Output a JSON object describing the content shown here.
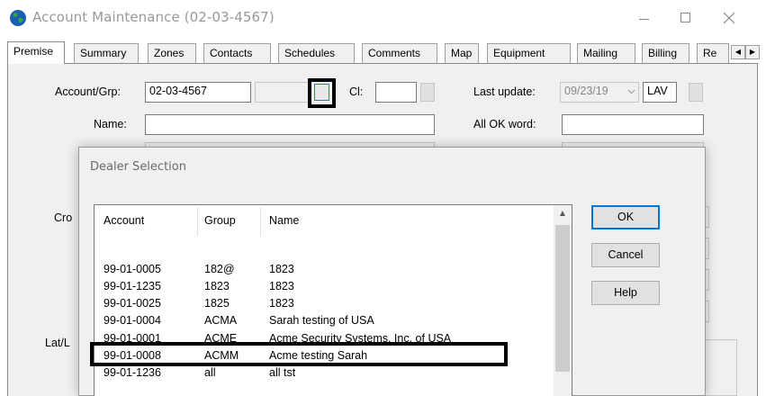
{
  "window": {
    "title": "Account Maintenance (02-03-4567)",
    "minimize_glyph": "—",
    "maximize_glyph": "☐",
    "close_glyph": "✕"
  },
  "tabs": [
    "Premise",
    "Summary",
    "Zones",
    "Contacts",
    "Schedules",
    "Comments",
    "Map",
    "Equipment",
    "Mailing",
    "Billing",
    "Re"
  ],
  "tab_scroll": {
    "left": "◀",
    "right": "▶"
  },
  "form": {
    "account_label": "Account/Grp:",
    "account_value": "02-03-4567",
    "cl_label": "Cl:",
    "cl_value": "",
    "last_update_label": "Last update:",
    "last_update_value": "09/23/19",
    "last_update_user": "LAV",
    "name_label": "Name:",
    "name_value": "",
    "all_ok_label": "All OK word:",
    "all_ok_value": "",
    "cross_label": "Cro",
    "latlong_label": "Lat/L"
  },
  "dialog": {
    "title": "Dealer Selection",
    "columns": [
      "Account",
      "Group",
      "Name"
    ],
    "rows": [
      {
        "account": "99-01-0005",
        "group": "182@",
        "name": "1823"
      },
      {
        "account": "99-01-1235",
        "group": "1823",
        "name": "1823"
      },
      {
        "account": "99-01-0025",
        "group": "1825",
        "name": "1823"
      },
      {
        "account": "99-01-0004",
        "group": "ACMA",
        "name": "Sarah testing of USA"
      },
      {
        "account": "99-01-0001",
        "group": "ACME",
        "name": "Acme Security Systems, Inc. of USA"
      },
      {
        "account": "99-01-0008",
        "group": "ACMM",
        "name": "Acme testing Sarah"
      },
      {
        "account": "99-01-1236",
        "group": "all",
        "name": "all tst"
      }
    ],
    "highlighted_row": 4,
    "buttons": {
      "ok": "OK",
      "cancel": "Cancel",
      "help": "Help"
    }
  },
  "colors": {
    "default_button_border": "#0078d7",
    "app_icon_blue": "#1a5fb4",
    "app_icon_green": "#3aa43a"
  }
}
